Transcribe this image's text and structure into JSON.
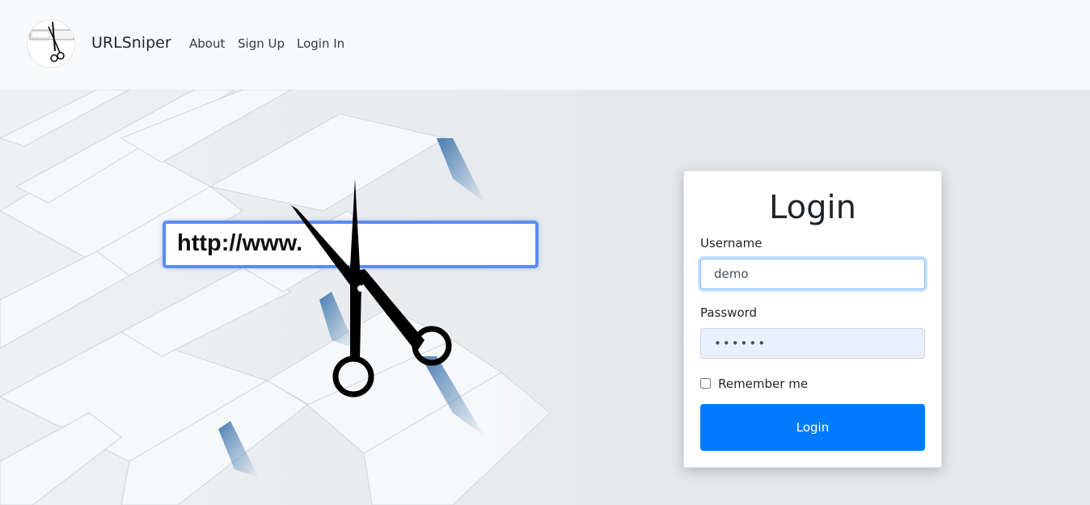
{
  "navbar": {
    "brand": "URLSniper",
    "logo_icon": "scissors-url-logo-icon",
    "links": [
      {
        "label": "About"
      },
      {
        "label": "Sign Up"
      },
      {
        "label": "Login In"
      }
    ]
  },
  "hero": {
    "url_text": "http://www.",
    "decor_icon": "scissors-icon"
  },
  "login": {
    "title": "Login",
    "username_label": "Username",
    "username_value": "demo",
    "password_label": "Password",
    "password_value": "••••••",
    "remember_label": "Remember me",
    "remember_checked": false,
    "submit_label": "Login"
  },
  "colors": {
    "primary": "#007bff",
    "navbar_bg": "#f8f9fa",
    "url_box_border": "#5b8cf0"
  }
}
